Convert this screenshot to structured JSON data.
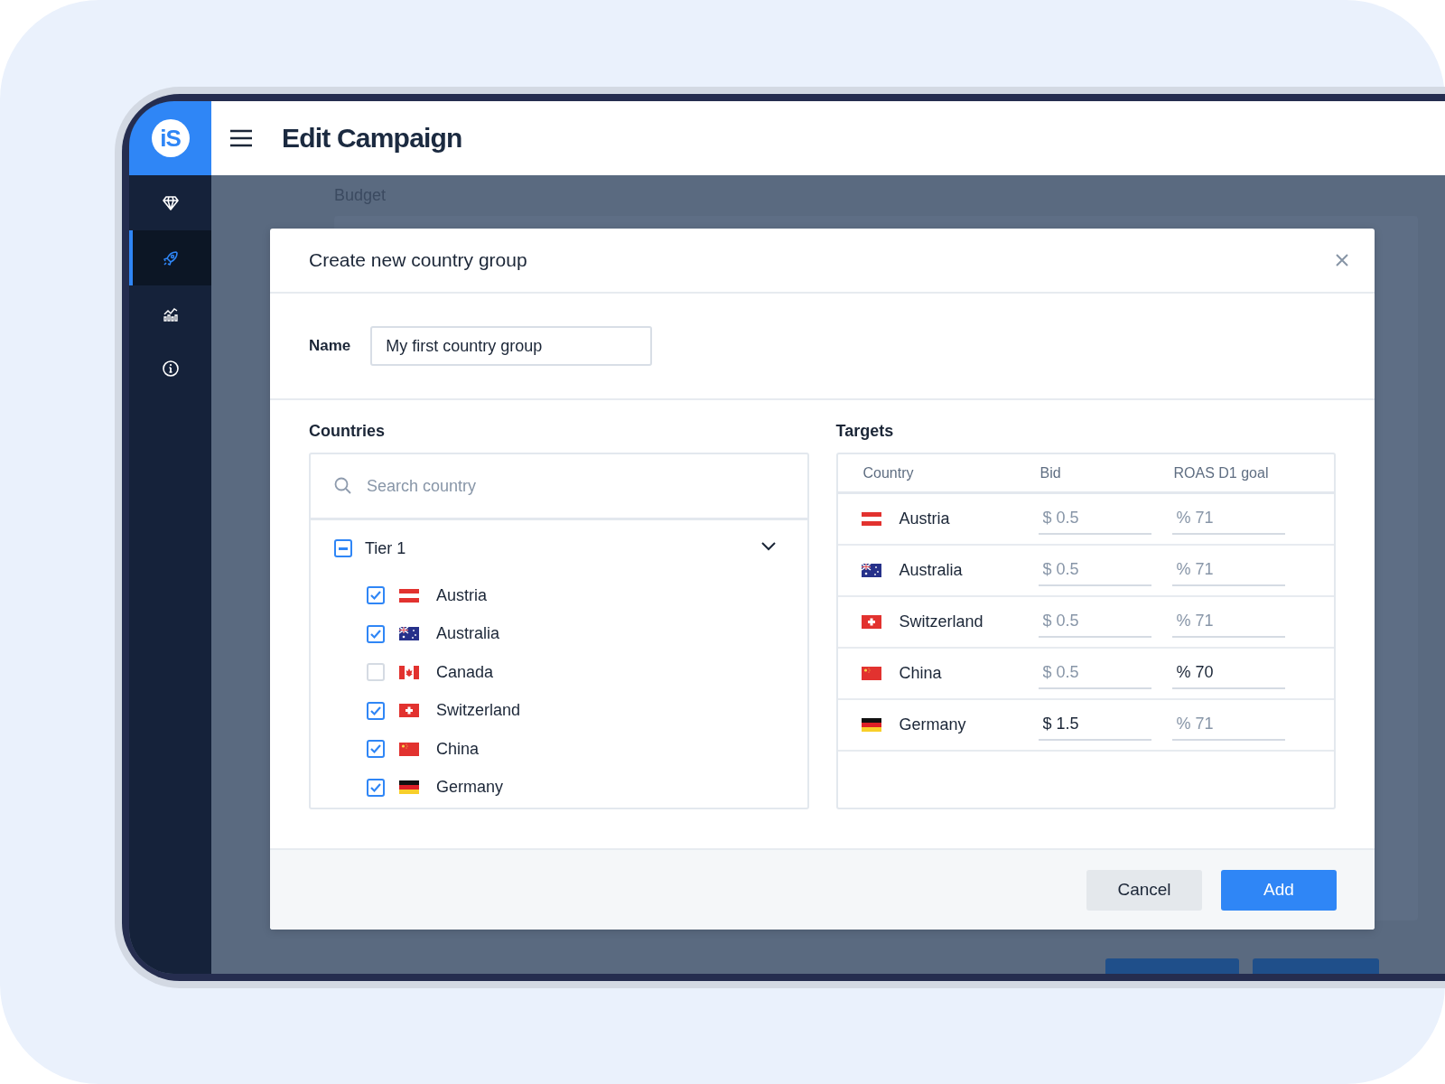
{
  "sidebar": {
    "logo": "iS",
    "nav": [
      {
        "selected": false
      },
      {
        "selected": true
      },
      {
        "selected": false
      },
      {
        "selected": false
      }
    ]
  },
  "header": {
    "title": "Edit Campaign"
  },
  "background": {
    "section_label": "Budget"
  },
  "dialog": {
    "title": "Create new country group",
    "name_field": {
      "label": "Name",
      "value": "My first country group"
    },
    "countries": {
      "heading": "Countries",
      "search": {
        "placeholder": "Search country"
      },
      "group": {
        "label": "Tier 1",
        "indeterminate": true,
        "expanded": true,
        "items": [
          {
            "name": "Austria",
            "kind": "at",
            "checked": true
          },
          {
            "name": "Australia",
            "kind": "au",
            "checked": true
          },
          {
            "name": "Canada",
            "kind": "ca",
            "checked": false
          },
          {
            "name": "Switzerland",
            "kind": "ch",
            "checked": true
          },
          {
            "name": "China",
            "kind": "cn",
            "checked": true
          },
          {
            "name": "Germany",
            "kind": "de",
            "checked": true
          }
        ]
      }
    },
    "targets": {
      "heading": "Targets",
      "columns": [
        "Country",
        "Bid",
        "ROAS D1 goal"
      ],
      "rows": [
        {
          "country": "Austria",
          "kind": "at",
          "bid": {
            "placeholder": "$ 0.5"
          },
          "goal": {
            "placeholder": "% 71"
          }
        },
        {
          "country": "Australia",
          "kind": "au",
          "bid": {
            "placeholder": "$ 0.5"
          },
          "goal": {
            "placeholder": "% 71"
          }
        },
        {
          "country": "Switzerland",
          "kind": "ch",
          "bid": {
            "placeholder": "$ 0.5"
          },
          "goal": {
            "placeholder": "% 71"
          }
        },
        {
          "country": "China",
          "kind": "cn",
          "bid": {
            "placeholder": "$ 0.5"
          },
          "goal": {
            "value": "% 70"
          }
        },
        {
          "country": "Germany",
          "kind": "de",
          "bid": {
            "value": "$ 1.5"
          },
          "goal": {
            "placeholder": "% 71"
          }
        }
      ]
    },
    "buttons": [
      {
        "label": "Cancel",
        "kind": "secondary"
      },
      {
        "label": "Add",
        "kind": "primary"
      }
    ]
  }
}
